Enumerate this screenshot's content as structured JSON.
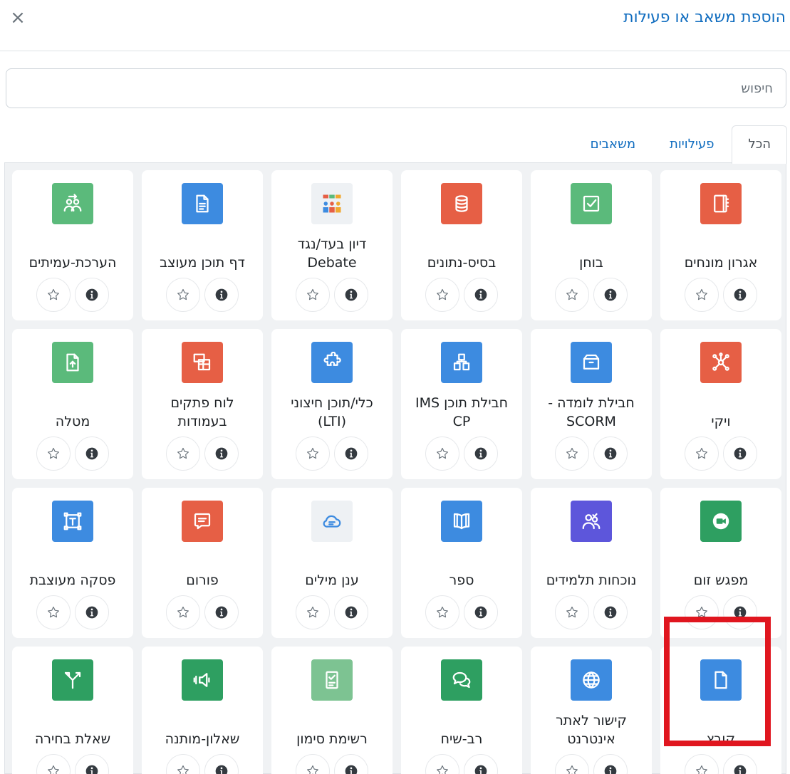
{
  "dialog": {
    "title": "הוספת משאב או פעילות",
    "close_label": "×"
  },
  "search": {
    "placeholder": "חיפוש"
  },
  "tabs": [
    {
      "label": "הכל",
      "active": true
    },
    {
      "label": "פעילויות",
      "active": false
    },
    {
      "label": "משאבים",
      "active": false
    }
  ],
  "modules": [
    {
      "name": "אגרון מונחים",
      "icon": "glossary-icon",
      "color": "#e65f45"
    },
    {
      "name": "בוחן",
      "icon": "quiz-icon",
      "color": "#5bba7b"
    },
    {
      "name": "בסיס-נתונים",
      "icon": "database-icon",
      "color": "#e65f45"
    },
    {
      "name": "דיון בעד/נגד Debate",
      "icon": "debate-icon",
      "color": "#eef1f4"
    },
    {
      "name": "דף תוכן מעוצב",
      "icon": "page-icon",
      "color": "#3d8be0"
    },
    {
      "name": "הערכת-עמיתים",
      "icon": "workshop-icon",
      "color": "#5bba7b"
    },
    {
      "name": "ויקי",
      "icon": "wiki-icon",
      "color": "#e65f45"
    },
    {
      "name": "חבילת לומדה - SCORM",
      "icon": "scorm-icon",
      "color": "#3d8be0"
    },
    {
      "name": "חבילת תוכן IMS CP",
      "icon": "ims-icon",
      "color": "#3d8be0"
    },
    {
      "name": "כלי/תוכן חיצוני (LTI)",
      "icon": "lti-icon",
      "color": "#3d8be0"
    },
    {
      "name": "לוח פתקים בעמודות",
      "icon": "board-icon",
      "color": "#e65f45"
    },
    {
      "name": "מטלה",
      "icon": "assignment-icon",
      "color": "#5bba7b"
    },
    {
      "name": "מפגש זום",
      "icon": "zoom-icon",
      "color": "#2e9f61"
    },
    {
      "name": "נוכחות תלמידים",
      "icon": "attendance-icon",
      "color": "#5d56db"
    },
    {
      "name": "ספר",
      "icon": "book-icon",
      "color": "#3d8be0"
    },
    {
      "name": "ענן מילים",
      "icon": "wordcloud-icon",
      "color": "#eef1f4"
    },
    {
      "name": "פורום",
      "icon": "forum-icon",
      "color": "#e65f45"
    },
    {
      "name": "פסקה מעוצבת",
      "icon": "label-icon",
      "color": "#3d8be0"
    },
    {
      "name": "קובץ",
      "icon": "file-icon",
      "color": "#3d8be0"
    },
    {
      "name": "קישור לאתר אינטרנט",
      "icon": "url-icon",
      "color": "#3d8be0"
    },
    {
      "name": "רב-שיח",
      "icon": "chat-icon",
      "color": "#2e9f61"
    },
    {
      "name": "רשימת סימון",
      "icon": "checklist-icon",
      "color": "#7dc392"
    },
    {
      "name": "שאלון-מותנה",
      "icon": "feedback-icon",
      "color": "#2e9f61"
    },
    {
      "name": "שאלת בחירה",
      "icon": "choice-icon",
      "color": "#2e9f61"
    }
  ],
  "highlight_color": "#e0161f"
}
